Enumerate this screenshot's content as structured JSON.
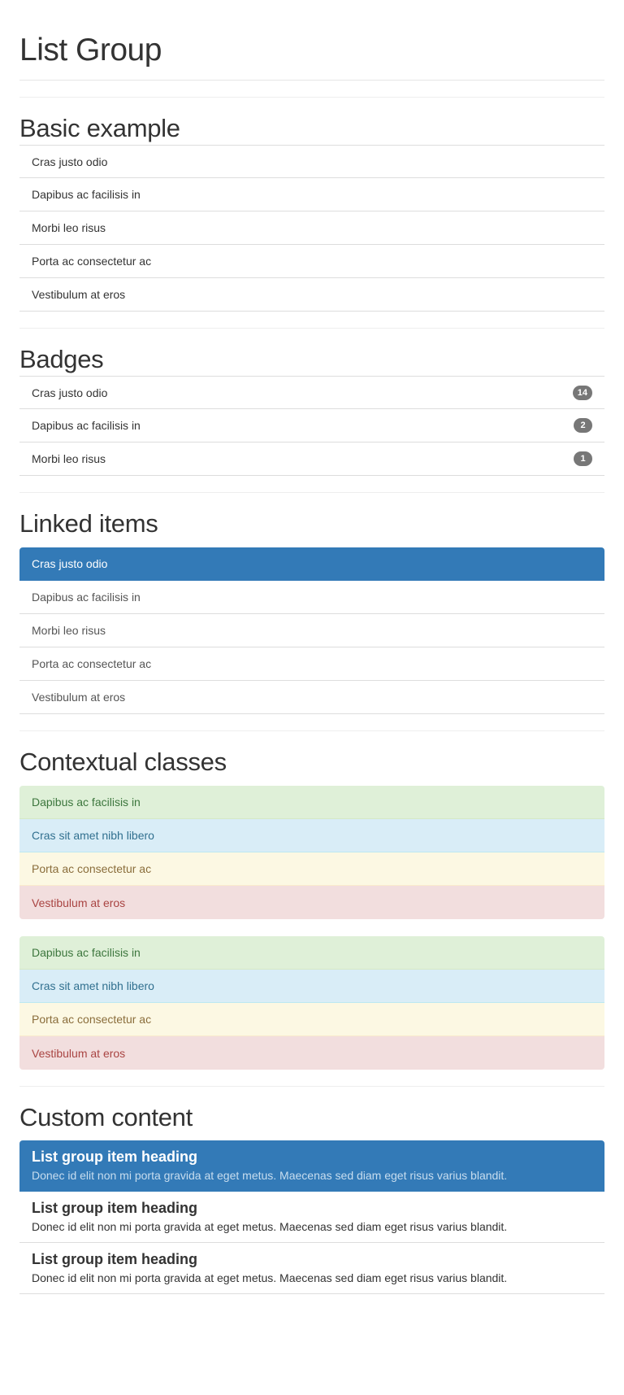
{
  "page_title": "List Group",
  "sections": {
    "basic": {
      "title": "Basic example",
      "items": [
        "Cras justo odio",
        "Dapibus ac facilisis in",
        "Morbi leo risus",
        "Porta ac consectetur ac",
        "Vestibulum at eros"
      ]
    },
    "badges": {
      "title": "Badges",
      "items": [
        {
          "label": "Cras justo odio",
          "badge": "14"
        },
        {
          "label": "Dapibus ac facilisis in",
          "badge": "2"
        },
        {
          "label": "Morbi leo risus",
          "badge": "1"
        }
      ]
    },
    "linked": {
      "title": "Linked items",
      "items": [
        "Cras justo odio",
        "Dapibus ac facilisis in",
        "Morbi leo risus",
        "Porta ac consectetur ac",
        "Vestibulum at eros"
      ]
    },
    "contextual": {
      "title": "Contextual classes",
      "group1": [
        "Dapibus ac facilisis in",
        "Cras sit amet nibh libero",
        "Porta ac consectetur ac",
        "Vestibulum at eros"
      ],
      "group2": [
        "Dapibus ac facilisis in",
        "Cras sit amet nibh libero",
        "Porta ac consectetur ac",
        "Vestibulum at eros"
      ]
    },
    "custom": {
      "title": "Custom content",
      "items": [
        {
          "heading": "List group item heading",
          "text": "Donec id elit non mi porta gravida at eget metus. Maecenas sed diam eget risus varius blandit."
        },
        {
          "heading": "List group item heading",
          "text": "Donec id elit non mi porta gravida at eget metus. Maecenas sed diam eget risus varius blandit."
        },
        {
          "heading": "List group item heading",
          "text": "Donec id elit non mi porta gravida at eget metus. Maecenas sed diam eget risus varius blandit."
        }
      ]
    }
  },
  "colors": {
    "primary": "#337ab7",
    "badge": "#777777",
    "success_bg": "#dff0d8",
    "info_bg": "#d9edf7",
    "warning_bg": "#fcf8e3",
    "danger_bg": "#f2dede"
  }
}
